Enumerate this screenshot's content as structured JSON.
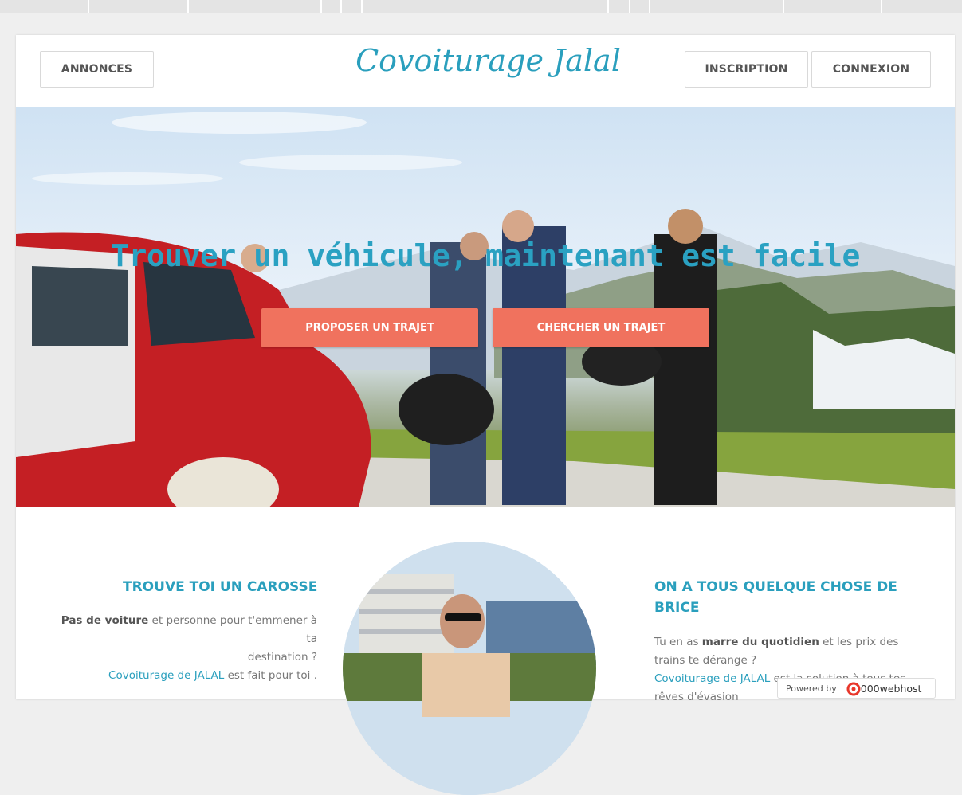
{
  "nav": {
    "annonces_label": "ANNONCES",
    "brand": "Covoiturage Jalal",
    "inscription_label": "INSCRIPTION",
    "connexion_label": "CONNEXION"
  },
  "hero": {
    "title": "Trouver un véhicule, maintenant est facile",
    "proposer_label": "PROPOSER UN TRAJET",
    "chercher_label": "CHERCHER UN TRAJET"
  },
  "left_col": {
    "title": "TROUVE TOI UN CAROSSE",
    "p1_bold": "Pas de voiture",
    "p1_rest": " et personne pour t'emmener à ta",
    "p2": "destination ?",
    "p3_link": "Covoiturage de JALAL",
    "p3_rest": " est fait pour toi ."
  },
  "right_col": {
    "title_line1": "ON A TOUS QUELQUE CHOSE DE",
    "title_line2": "BRICE",
    "p1_pre": "Tu en as ",
    "p1_bold": "marre du quotidien",
    "p1_rest": " et les prix des",
    "p2": "trains te dérange ?",
    "p3_link": "Covoiturage de JALAL",
    "p3_rest": " est la solution à tous tes",
    "p4": "rêves d'évasion"
  },
  "badge": {
    "powered": "Powered by",
    "host": "000webhost"
  },
  "colors": {
    "accent": "#2a9fbd",
    "cta": "#f0725e"
  },
  "icons": {
    "webhost_logo": "000webhost-logo-icon"
  }
}
